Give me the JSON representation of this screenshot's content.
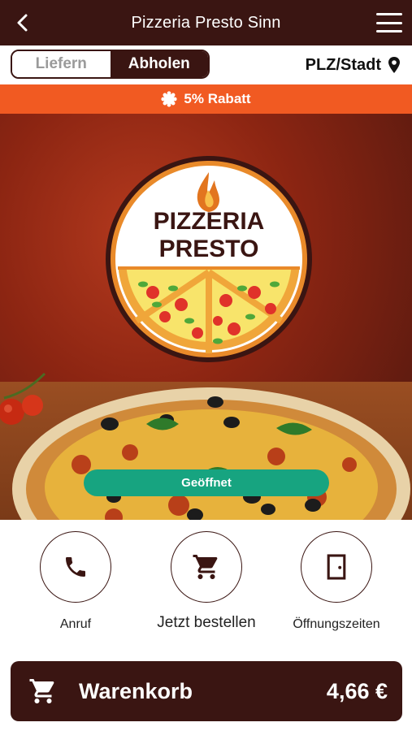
{
  "header": {
    "title": "Pizzeria Presto Sinn",
    "back_icon": "chevron-left-icon",
    "menu_icon": "hamburger-menu-icon"
  },
  "mode_toggle": {
    "deliver_label": "Liefern",
    "pickup_label": "Abholen",
    "selected": "Abholen"
  },
  "location": {
    "label": "PLZ/Stadt",
    "icon": "map-pin-icon"
  },
  "promo": {
    "icon": "badge-icon",
    "text": "5% Rabatt"
  },
  "hero": {
    "logo_line1": "PIZZERIA",
    "logo_line2": "PRESTO",
    "status_label": "Geöffnet"
  },
  "actions": [
    {
      "label": "Anruf",
      "icon": "phone-icon"
    },
    {
      "label": "Jetzt bestellen",
      "icon": "shopping-cart-icon"
    },
    {
      "label": "Öffnungszeiten",
      "icon": "door-icon"
    }
  ],
  "cart": {
    "label": "Warenkorb",
    "total": "4,66 €",
    "icon": "shopping-cart-icon"
  },
  "colors": {
    "brand_dark": "#3a1512",
    "promo_orange": "#f15a22",
    "open_green": "#17a480"
  }
}
